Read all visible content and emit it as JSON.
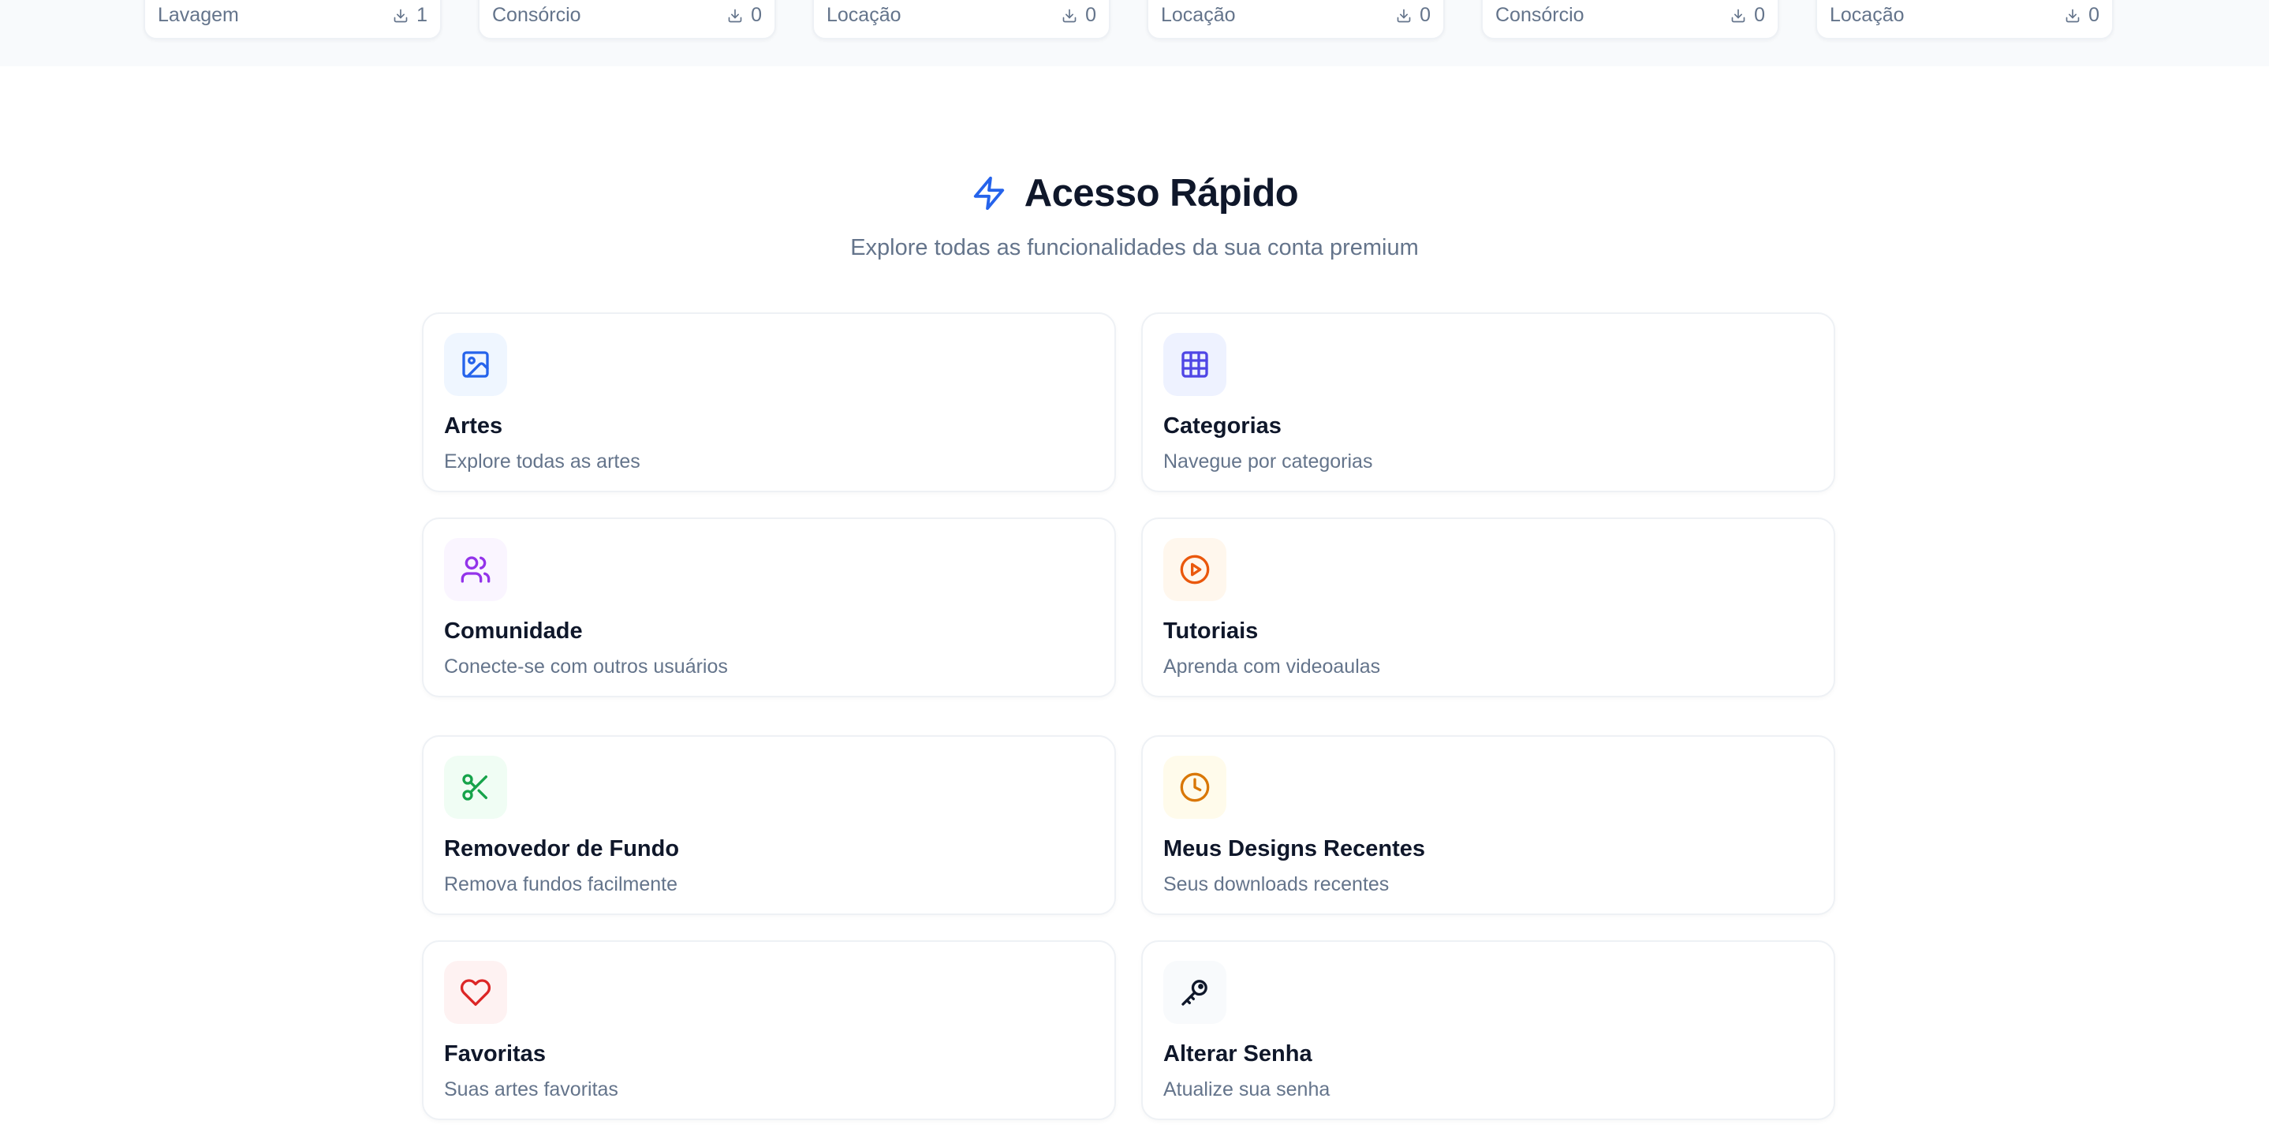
{
  "downloads_strip": [
    {
      "category": "Lavagem",
      "count": "1"
    },
    {
      "category": "Consórcio",
      "count": "0"
    },
    {
      "category": "Locação",
      "count": "0"
    },
    {
      "category": "Locação",
      "count": "0"
    },
    {
      "category": "Consórcio",
      "count": "0"
    },
    {
      "category": "Locação",
      "count": "0"
    }
  ],
  "quick_access": {
    "title": "Acesso Rápido",
    "subtitle": "Explore todas as funcionalidades da sua conta premium",
    "icon": "lightning-icon",
    "accent": "#2563eb",
    "cards": [
      {
        "title": "Artes",
        "description": "Explore todas as artes",
        "icon": "image-icon",
        "color": "#2563eb",
        "bg": "#eff6ff"
      },
      {
        "title": "Categorias",
        "description": "Navegue por categorias",
        "icon": "grid-icon",
        "color": "#4f46e5",
        "bg": "#eef2ff"
      },
      {
        "title": "Comunidade",
        "description": "Conecte-se com outros usuários",
        "icon": "users-icon",
        "color": "#9333ea",
        "bg": "#faf5ff"
      },
      {
        "title": "Tutoriais",
        "description": "Aprenda com videoaulas",
        "icon": "play-circle-icon",
        "color": "#ea580c",
        "bg": "#fff7ed"
      },
      {
        "title": "Removedor de Fundo",
        "description": "Remova fundos facilmente",
        "icon": "scissors-icon",
        "color": "#16a34a",
        "bg": "#f0fdf4"
      },
      {
        "title": "Meus Designs Recentes",
        "description": "Seus downloads recentes",
        "icon": "clock-icon",
        "color": "#d97706",
        "bg": "#fffbeb"
      },
      {
        "title": "Favoritas",
        "description": "Suas artes favoritas",
        "icon": "heart-icon",
        "color": "#dc2626",
        "bg": "#fef2f2"
      },
      {
        "title": "Alterar Senha",
        "description": "Atualize sua senha",
        "icon": "key-icon",
        "color": "#0f172a",
        "bg": "#f8fafc"
      }
    ]
  }
}
